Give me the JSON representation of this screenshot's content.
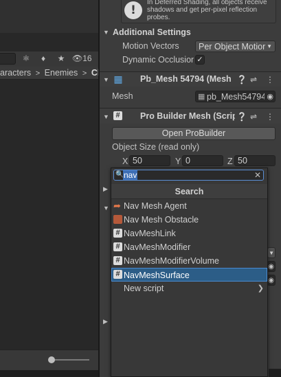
{
  "left_panel": {
    "visible_count": "16",
    "breadcrumb": [
      "aracters",
      "Enemies",
      "Ch"
    ]
  },
  "inspector": {
    "help_text": "In Deferred Shading, all objects receive shadows and get per-pixel reflection probes.",
    "additional_settings": {
      "title": "Additional Settings",
      "motion_vectors_label": "Motion Vectors",
      "motion_vectors_value": "Per Object Motior",
      "dynamic_occlusion_label": "Dynamic Occlusion",
      "dynamic_occlusion_checked": "✓"
    },
    "mesh_filter": {
      "title": "Pb_Mesh 54794 (Mesh",
      "mesh_label": "Mesh",
      "mesh_value": "pb_Mesh54794"
    },
    "probuilder_mesh": {
      "title": "Pro Builder Mesh (Scrip",
      "open_button": "Open ProBuilder",
      "object_size_label": "Object Size (read only)",
      "x_label": "X",
      "x_value": "50",
      "y_label": "Y",
      "y_value": "0",
      "z_label": "Z",
      "z_value": "50"
    }
  },
  "popup": {
    "search_value": "nav",
    "title": "Search",
    "items": [
      {
        "label": "Nav Mesh Agent",
        "icon": "nav-mesh-agent-icon"
      },
      {
        "label": "Nav Mesh Obstacle",
        "icon": "nav-mesh-obstacle-icon"
      },
      {
        "label": "NavMeshLink",
        "icon": "script-icon"
      },
      {
        "label": "NavMeshModifier",
        "icon": "script-icon"
      },
      {
        "label": "NavMeshModifierVolume",
        "icon": "script-icon"
      },
      {
        "label": "NavMeshSurface",
        "icon": "script-icon"
      },
      {
        "label": "New script",
        "icon": ""
      }
    ]
  },
  "colors": {
    "selection": "#2c5d87",
    "selection_border": "#4a8ad0",
    "search_highlight": "#3d6eb5"
  }
}
